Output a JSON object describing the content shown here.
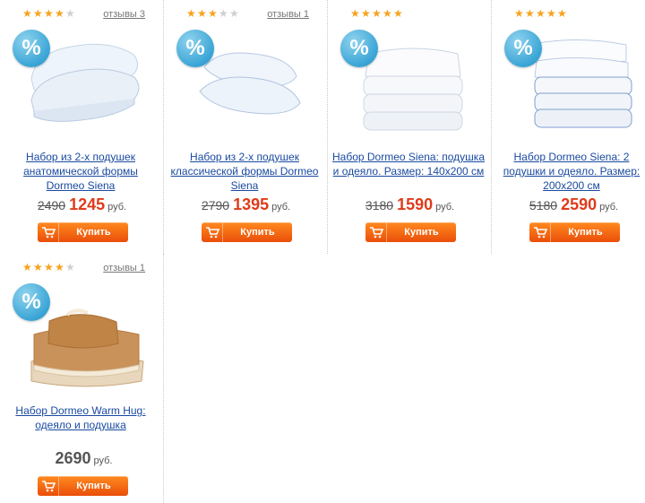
{
  "colors": {
    "accent": "#e03a1a",
    "button": "#f26a12",
    "link": "#1a4aa0",
    "star": "#f7a21b",
    "badge": "#3aa5d6"
  },
  "badge_symbol": "%",
  "products": [
    {
      "rating": 4,
      "reviews": "отзывы 3",
      "title": "Набор из 2-х подушек анатомической формы Dormeo Siena",
      "old_price": "2490",
      "price": "1245",
      "currency": "руб.",
      "buy_label": "Купить",
      "image": "pillows-anatomic"
    },
    {
      "rating": 3,
      "reviews": "отзывы 1",
      "title": "Набор из 2-х подушек классической формы Dormeo Siena",
      "old_price": "2790",
      "price": "1395",
      "currency": "руб.",
      "buy_label": "Купить",
      "image": "pillows-classic"
    },
    {
      "rating": 4.5,
      "reviews": "",
      "title": "Набор Dormeo Siena: подушка и одеяло. Размер: 140х200 см",
      "old_price": "3180",
      "price": "1590",
      "currency": "руб.",
      "buy_label": "Купить",
      "image": "pillow-blanket"
    },
    {
      "rating": 5,
      "reviews": "",
      "title": "Набор Dormeo Siena: 2 подушки и одеяло. Размер: 200х200 см",
      "old_price": "5180",
      "price": "2590",
      "currency": "руб.",
      "buy_label": "Купить",
      "image": "pillows-blanket-large"
    },
    {
      "rating": 4,
      "reviews": "отзывы 1",
      "title": "Набор Dormeo Warm Hug: одеяло и подушка",
      "old_price": "",
      "price": "2690",
      "currency": "руб.",
      "buy_label": "Купить",
      "image": "warm-hug-set"
    }
  ]
}
